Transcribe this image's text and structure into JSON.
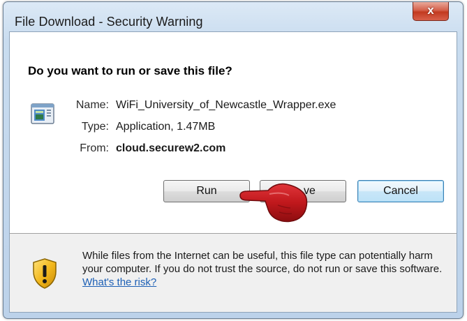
{
  "window": {
    "title": "File Download - Security Warning",
    "close_label": "x"
  },
  "dialog": {
    "question": "Do you want to run or save this file?",
    "file_icon": "executable-file-icon",
    "name_label": "Name:",
    "name_value": "WiFi_University_of_Newcastle_Wrapper.exe",
    "type_label": "Type:",
    "type_value": "Application, 1.47MB",
    "from_label": "From:",
    "from_value": "cloud.securew2.com"
  },
  "buttons": {
    "run": "Run",
    "save": "Save",
    "save_visible": "ve",
    "cancel": "Cancel"
  },
  "overlay": {
    "pointer_icon": "pointing-hand-icon",
    "color": "#c0181c"
  },
  "footer": {
    "shield_icon": "shield-warning-icon",
    "warning_text": "While files from the Internet can be useful, this file type can potentially harm your computer. If you do not trust the source, do not run or save this software.",
    "link_text": "What's the risk?"
  },
  "colors": {
    "titlebar": "#c9dcef",
    "close_button": "#c23a20",
    "link": "#1c5fb5",
    "default_button_border": "#3c7fb1"
  }
}
